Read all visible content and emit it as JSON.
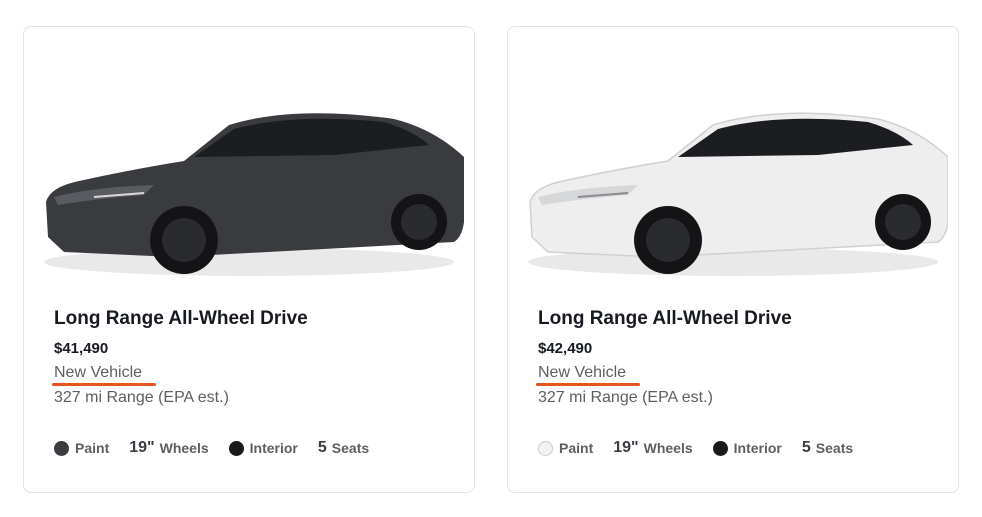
{
  "cards": [
    {
      "image_icon": "car-dark-gray",
      "title": "Long Range All-Wheel Drive",
      "price": "$41,490",
      "condition": "New Vehicle",
      "range": "327 mi Range (EPA est.)",
      "paint_label": "Paint",
      "paint_color": "#3b3c40",
      "wheels_value": "19\"",
      "wheels_label": "Wheels",
      "interior_label": "Interior",
      "interior_color": "#1a1a1a",
      "seats_value": "5",
      "seats_label": "Seats"
    },
    {
      "image_icon": "car-white",
      "title": "Long Range All-Wheel Drive",
      "price": "$42,490",
      "condition": "New Vehicle",
      "range": "327 mi Range (EPA est.)",
      "paint_label": "Paint",
      "paint_color": "#f2f2f2",
      "wheels_value": "19\"",
      "wheels_label": "Wheels",
      "interior_label": "Interior",
      "interior_color": "#1a1a1a",
      "seats_value": "5",
      "seats_label": "Seats"
    }
  ],
  "accent_color": "#e4541b"
}
